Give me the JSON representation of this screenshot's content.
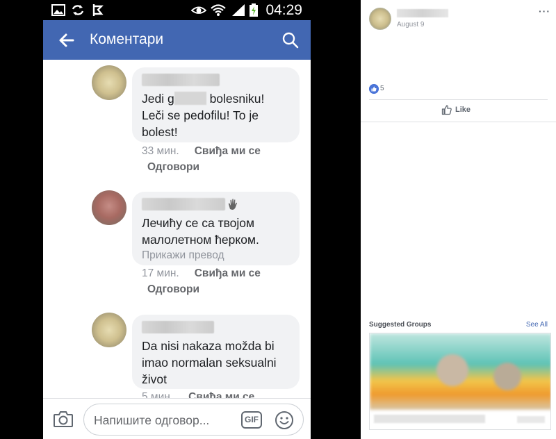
{
  "status_bar": {
    "time": "04:29"
  },
  "app_bar": {
    "title": "Коментари"
  },
  "comments": [
    {
      "text_before": "Jedi g",
      "text_after": " bolesniku! Leči se pedofilu! To je bolest!",
      "time": "33 мин.",
      "like_label": "Свиђа ми се",
      "reply_label": "Одговори"
    },
    {
      "text": "Лечићу се са твојом малолетном ћерком.",
      "translate_label": "Прикажи превод",
      "time": "17 мин.",
      "like_label": "Свиђа ми се",
      "reply_label": "Одговори"
    },
    {
      "text": "Da nisi nakaza možda bi imao normalan seksualni život",
      "time": "5 мин.",
      "like_label": "Свиђа ми се"
    }
  ],
  "composer": {
    "placeholder": "Напишите одговор...",
    "gif_label": "GIF"
  },
  "post": {
    "date": "August 9",
    "reaction_count": "5",
    "like_label": "Like",
    "more_label": "···"
  },
  "suggested_groups": {
    "title": "Suggested Groups",
    "see_all": "See All"
  },
  "colors": {
    "facebook_blue": "#4267b2",
    "bubble_bg": "#f1f2f4",
    "meta_gray": "#90949c"
  }
}
